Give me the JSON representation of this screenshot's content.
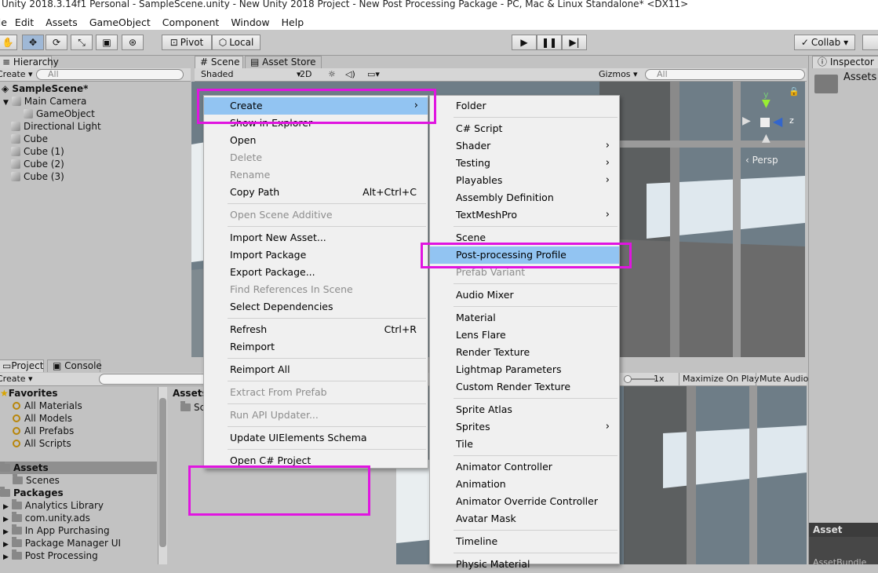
{
  "window": {
    "title": "Unity 2018.3.14f1 Personal - SampleScene.unity - New Unity 2018 Project - New Post Processing Package - PC, Mac & Linux Standalone* <DX11>"
  },
  "menubar": {
    "items": [
      "File",
      "Edit",
      "Assets",
      "GameObject",
      "Component",
      "Window",
      "Help"
    ]
  },
  "toolbar": {
    "pivot": "Pivot",
    "local": "Local",
    "collab": "Collab ▾"
  },
  "hierarchy": {
    "tab": "Hierarchy",
    "create": "Create ▾",
    "search_placeholder": "All",
    "scene": "SampleScene*",
    "items": [
      "Main Camera",
      "GameObject",
      "Directional Light",
      "Cube",
      "Cube (1)",
      "Cube (2)",
      "Cube (3)"
    ]
  },
  "scene_view": {
    "tab_scene": "Scene",
    "tab_store": "Asset Store",
    "shading": "Shaded",
    "mode_2d": "2D",
    "gizmos": "Gizmos ▾",
    "search_placeholder": "All",
    "persp": "‹ Persp",
    "axis_y": "y",
    "axis_z": "z"
  },
  "inspector": {
    "tab": "Inspector",
    "title": "Assets",
    "labels_header": "Asset Labels",
    "bundle": "AssetBundle"
  },
  "project": {
    "tab_project": "Project",
    "tab_console": "Console",
    "create": "Create ▾",
    "favorites_header": "Favorites",
    "favorites": [
      "All Materials",
      "All Models",
      "All Prefabs",
      "All Scripts"
    ],
    "assets_header": "Assets",
    "assets_items": [
      "Scenes"
    ],
    "packages_header": "Packages",
    "packages": [
      "Analytics Library",
      "com.unity.ads",
      "In App Purchasing",
      "Package Manager UI",
      "Post Processing"
    ],
    "breadcrumb": "Assets",
    "folder_short": "Sc"
  },
  "game_view": {
    "scale": "1x",
    "maximize": "Maximize On Play",
    "mute": "Mute Audio"
  },
  "context_menu": {
    "items": [
      {
        "label": "Create",
        "state": "highlight",
        "submenu": true
      },
      {
        "label": "Show in Explorer"
      },
      {
        "label": "Open"
      },
      {
        "label": "Delete",
        "state": "disabled"
      },
      {
        "label": "Rename",
        "state": "disabled"
      },
      {
        "label": "Copy Path",
        "shortcut": "Alt+Ctrl+C"
      },
      {
        "label": "Open Scene Additive",
        "state": "disabled"
      },
      {
        "label": "Import New Asset..."
      },
      {
        "label": "Import Package"
      },
      {
        "label": "Export Package..."
      },
      {
        "label": "Find References In Scene",
        "state": "disabled"
      },
      {
        "label": "Select Dependencies"
      },
      {
        "label": "Refresh",
        "shortcut": "Ctrl+R"
      },
      {
        "label": "Reimport"
      },
      {
        "label": "Reimport All"
      },
      {
        "label": "Extract From Prefab",
        "state": "disabled"
      },
      {
        "label": "Run API Updater...",
        "state": "disabled"
      },
      {
        "label": "Update UIElements Schema"
      },
      {
        "label": "Open C# Project"
      }
    ]
  },
  "create_submenu": {
    "items": [
      {
        "label": "Folder"
      },
      {
        "label": "C# Script"
      },
      {
        "label": "Shader",
        "submenu": true
      },
      {
        "label": "Testing",
        "submenu": true
      },
      {
        "label": "Playables",
        "submenu": true
      },
      {
        "label": "Assembly Definition"
      },
      {
        "label": "TextMeshPro",
        "submenu": true
      },
      {
        "label": "Scene"
      },
      {
        "label": "Post-processing Profile",
        "state": "highlight"
      },
      {
        "label": "Prefab Variant",
        "state": "disabled"
      },
      {
        "label": "Audio Mixer"
      },
      {
        "label": "Material"
      },
      {
        "label": "Lens Flare"
      },
      {
        "label": "Render Texture"
      },
      {
        "label": "Lightmap Parameters"
      },
      {
        "label": "Custom Render Texture"
      },
      {
        "label": "Sprite Atlas"
      },
      {
        "label": "Sprites",
        "submenu": true
      },
      {
        "label": "Tile"
      },
      {
        "label": "Animator Controller"
      },
      {
        "label": "Animation"
      },
      {
        "label": "Animator Override Controller"
      },
      {
        "label": "Avatar Mask"
      },
      {
        "label": "Timeline"
      },
      {
        "label": "Physic Material"
      }
    ]
  },
  "colors": {
    "highlight": "#92c4f2",
    "annotation": "#e015e0",
    "panel": "#c2c2c2"
  }
}
